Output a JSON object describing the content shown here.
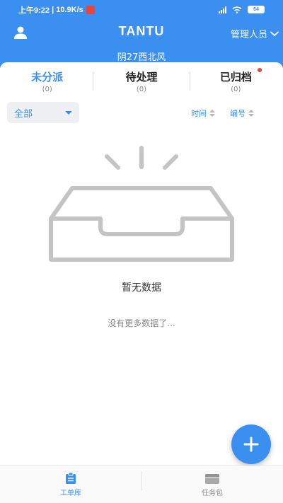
{
  "status_bar": {
    "time": "上午9:22",
    "speed": "10.9K/s",
    "battery": "64"
  },
  "header": {
    "title": "TANTU",
    "role": "管理人员",
    "weather": "阴27西北风"
  },
  "tabs": [
    {
      "label": "未分派",
      "count": "(0)",
      "active": true
    },
    {
      "label": "待处理",
      "count": "(0)",
      "active": false
    },
    {
      "label": "已归档",
      "count": "(0)",
      "active": false,
      "has_dot": true
    }
  ],
  "filter": {
    "selected": "全部"
  },
  "sort": {
    "time_label": "时间",
    "number_label": "编号"
  },
  "empty": {
    "message": "暂无数据",
    "no_more": "没有更多数据了..."
  },
  "bottom_nav": [
    {
      "label": "工单库",
      "icon": "clipboard-icon",
      "active": true
    },
    {
      "label": "任务包",
      "icon": "package-icon",
      "active": false
    }
  ],
  "colors": {
    "accent": "#3b8ff0",
    "illustration": "#c4c4c4",
    "badge": "#e9453b"
  }
}
